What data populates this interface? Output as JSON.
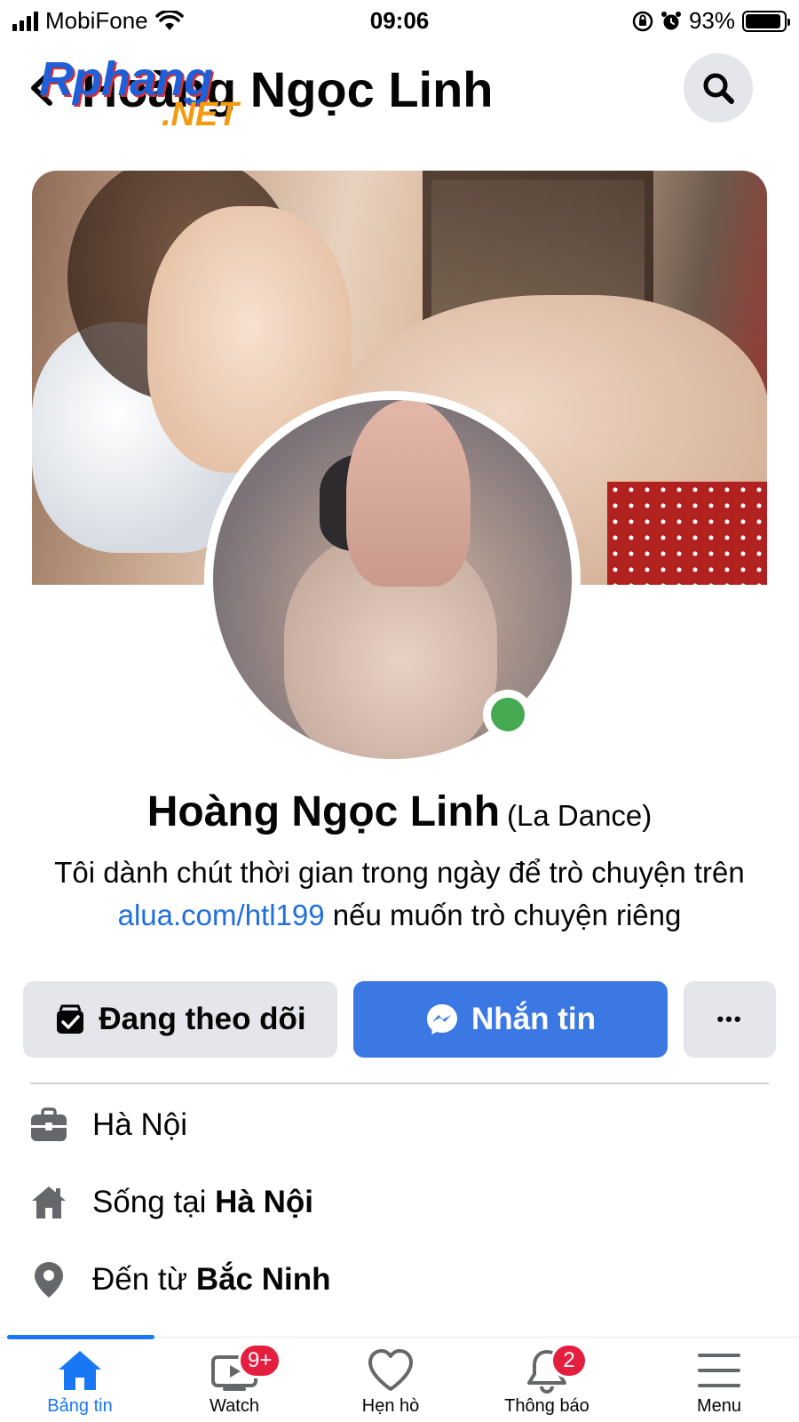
{
  "status_bar": {
    "carrier": "MobiFone",
    "time": "09:06",
    "battery": "93%",
    "battery_level": 0.93
  },
  "watermark": {
    "main": "Rphang",
    "sub": ".NET"
  },
  "header": {
    "title": "Hoàng Ngọc Linh"
  },
  "profile": {
    "name": "Hoàng Ngọc Linh",
    "alt_name": "(La Dance)",
    "bio_prefix": "Tôi dành chút thời gian trong ngày để trò chuyện trên ",
    "bio_link": "alua.com/htl199",
    "bio_suffix": " nếu muốn trò chuyện riêng",
    "online": true,
    "online_color": "#45a952"
  },
  "actions": {
    "follow_label": "Đang theo dõi",
    "message_label": "Nhắn tin",
    "more_label": "•••"
  },
  "info": [
    {
      "icon": "briefcase-icon",
      "text": "Hà Nội"
    },
    {
      "icon": "home-icon",
      "prefix": "Sống tại ",
      "bold": "Hà Nội"
    },
    {
      "icon": "location-pin-icon",
      "prefix": "Đến từ ",
      "bold": "Bắc Ninh"
    }
  ],
  "tabbar": {
    "tabs": [
      {
        "label": "Bảng tin",
        "icon": "home-icon",
        "active": true
      },
      {
        "label": "Watch",
        "icon": "watch-icon",
        "badge": "9+"
      },
      {
        "label": "Hẹn hò",
        "icon": "heart-icon"
      },
      {
        "label": "Thông báo",
        "icon": "bell-icon",
        "badge": "2"
      },
      {
        "label": "Menu",
        "icon": "menu-icon"
      }
    ]
  },
  "colors": {
    "accent": "#1877f2",
    "message_button": "#3b78e3",
    "link": "#216fdb",
    "badge": "#e41e3f"
  }
}
